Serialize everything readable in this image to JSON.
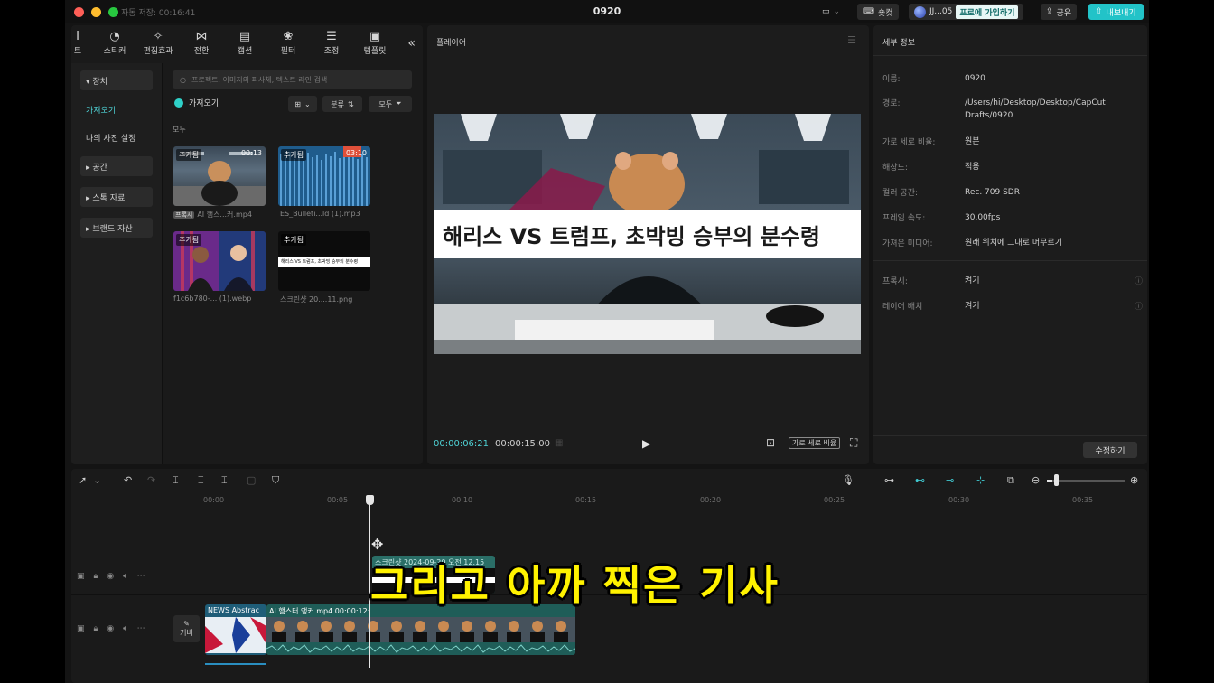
{
  "titlebar": {
    "autosave": "자동 저장: 00:16:41",
    "title": "0920",
    "shortcut_label": "숏컷",
    "account_label": "JJ...05",
    "pro_label": "프로에 가입하기",
    "share_label": "공유",
    "export_label": "내보내기"
  },
  "toolbar": {
    "items": [
      {
        "label": "트",
        "icon": "text-icon"
      },
      {
        "label": "스티커",
        "icon": "sticker-icon"
      },
      {
        "label": "편집효과",
        "icon": "effects-icon"
      },
      {
        "label": "전환",
        "icon": "transition-icon"
      },
      {
        "label": "캡션",
        "icon": "caption-icon"
      },
      {
        "label": "필터",
        "icon": "filter-icon"
      },
      {
        "label": "조정",
        "icon": "adjust-icon"
      },
      {
        "label": "템플릿",
        "icon": "template-icon"
      }
    ]
  },
  "sidebar": {
    "items": [
      {
        "label": "▾ 장치"
      },
      {
        "label": "가져오기"
      },
      {
        "label": "나의 사진 설정"
      },
      {
        "label": "▸ 공간"
      },
      {
        "label": "▸ 스톡 자료"
      },
      {
        "label": "▸ 브랜드 자산"
      }
    ]
  },
  "media": {
    "search_placeholder": "프로젝트, 이미지의 피사체, 텍스트 라인 검색",
    "import_label": "가져오기",
    "sort_label": "분류",
    "filter_label": "모두",
    "section_all": "모두",
    "items": [
      {
        "added": "추가됨",
        "duration": "00:13",
        "name": "AI 햄스...커.mp4",
        "tag": "프록시"
      },
      {
        "added": "추가됨",
        "duration": "03:10",
        "name": "ES_Bulleti...ld (1).mp3",
        "tag": ""
      },
      {
        "added": "추가됨",
        "duration": "",
        "name": "f1c6b780-... (1).webp",
        "tag": ""
      },
      {
        "added": "추가됨",
        "duration": "",
        "name": "스크린샷 20....11.png",
        "tag": ""
      }
    ],
    "mini_caption": "해리스 VS 트럼프, 초박빙 승부의 분수령"
  },
  "player": {
    "title": "플레이어",
    "caption": "해리스 VS 트럼프, 초박빙 승부의 분수령",
    "current_time": "00:00:06:21",
    "total_time": "00:00:15:00",
    "ratio_label": "가로 세로 비율"
  },
  "details": {
    "title": "세부 정보",
    "rows": [
      {
        "key": "이름:",
        "value": "0920"
      },
      {
        "key": "경로:",
        "value": "/Users/hi/Desktop/Desktop/CapCut Drafts/0920"
      },
      {
        "key": "가로 세로 비율:",
        "value": "원본"
      },
      {
        "key": "해상도:",
        "value": "적용"
      },
      {
        "key": "컬러 공간:",
        "value": "Rec. 709 SDR"
      },
      {
        "key": "프레임 속도:",
        "value": "30.00fps"
      },
      {
        "key": "가져온 미디어:",
        "value": "원래 위치에 그대로 머무르기"
      },
      {
        "key": "프록시:",
        "value": "켜기"
      },
      {
        "key": "레이어 배치",
        "value": "켜기"
      }
    ],
    "edit_label": "수정하기"
  },
  "timeline": {
    "ticks": [
      "00:00",
      "00:05",
      "00:10",
      "00:15",
      "00:20",
      "00:25",
      "00:30",
      "00:35"
    ],
    "clip_top_label": "스크린샷 2024-09-20 오전 12.15",
    "clip_news_label": "NEWS Abstrac",
    "clip_main_label": "AI 햄스터 앵커.mp4  00:00:12:",
    "cover_label": "커버",
    "subtitle": "그리고 아까 찍은 기사"
  },
  "colors": {
    "accent": "#22c3c8",
    "subtitle": "#fff200",
    "timecode": "#4fd3d6"
  }
}
